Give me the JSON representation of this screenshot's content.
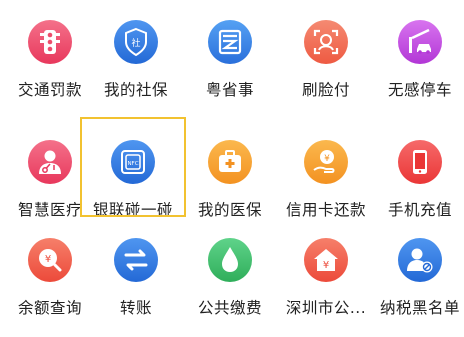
{
  "grid": {
    "items": [
      {
        "label": "交通罚款",
        "icon": "traffic-light-icon",
        "color": "#f0506e"
      },
      {
        "label": "我的社保",
        "icon": "social-security-shield-icon",
        "color": "#2f7de1"
      },
      {
        "label": "粤省事",
        "icon": "yue-sheng-shi-logo-icon",
        "color": "#3a86e8"
      },
      {
        "label": "刷脸付",
        "icon": "face-scan-icon",
        "color": "#f16b55"
      },
      {
        "label": "无感停车",
        "icon": "barrier-car-icon",
        "color": "#c44de0"
      },
      {
        "label": "智慧医疗",
        "icon": "doctor-icon",
        "color": "#f0506e"
      },
      {
        "label": "银联碰一碰",
        "icon": "nfc-card-icon",
        "color": "#2f7de1"
      },
      {
        "label": "我的医保",
        "icon": "medical-kit-icon",
        "color": "#f7a12c"
      },
      {
        "label": "信用卡还款",
        "icon": "yuan-hand-icon",
        "color": "#f7a12c"
      },
      {
        "label": "手机充值",
        "icon": "phone-icon",
        "color": "#f24a4a"
      },
      {
        "label": "余额查询",
        "icon": "yuan-search-icon",
        "color": "#f05a4a"
      },
      {
        "label": "转账",
        "icon": "transfer-arrows-icon",
        "color": "#2f7de1"
      },
      {
        "label": "公共缴费",
        "icon": "water-drop-icon",
        "color": "#3dbf6a"
      },
      {
        "label": "深圳市公...",
        "icon": "yuan-house-icon",
        "color": "#f05a4a"
      },
      {
        "label": "纳税黑名单",
        "icon": "user-block-icon",
        "color": "#2f7de1"
      }
    ]
  }
}
